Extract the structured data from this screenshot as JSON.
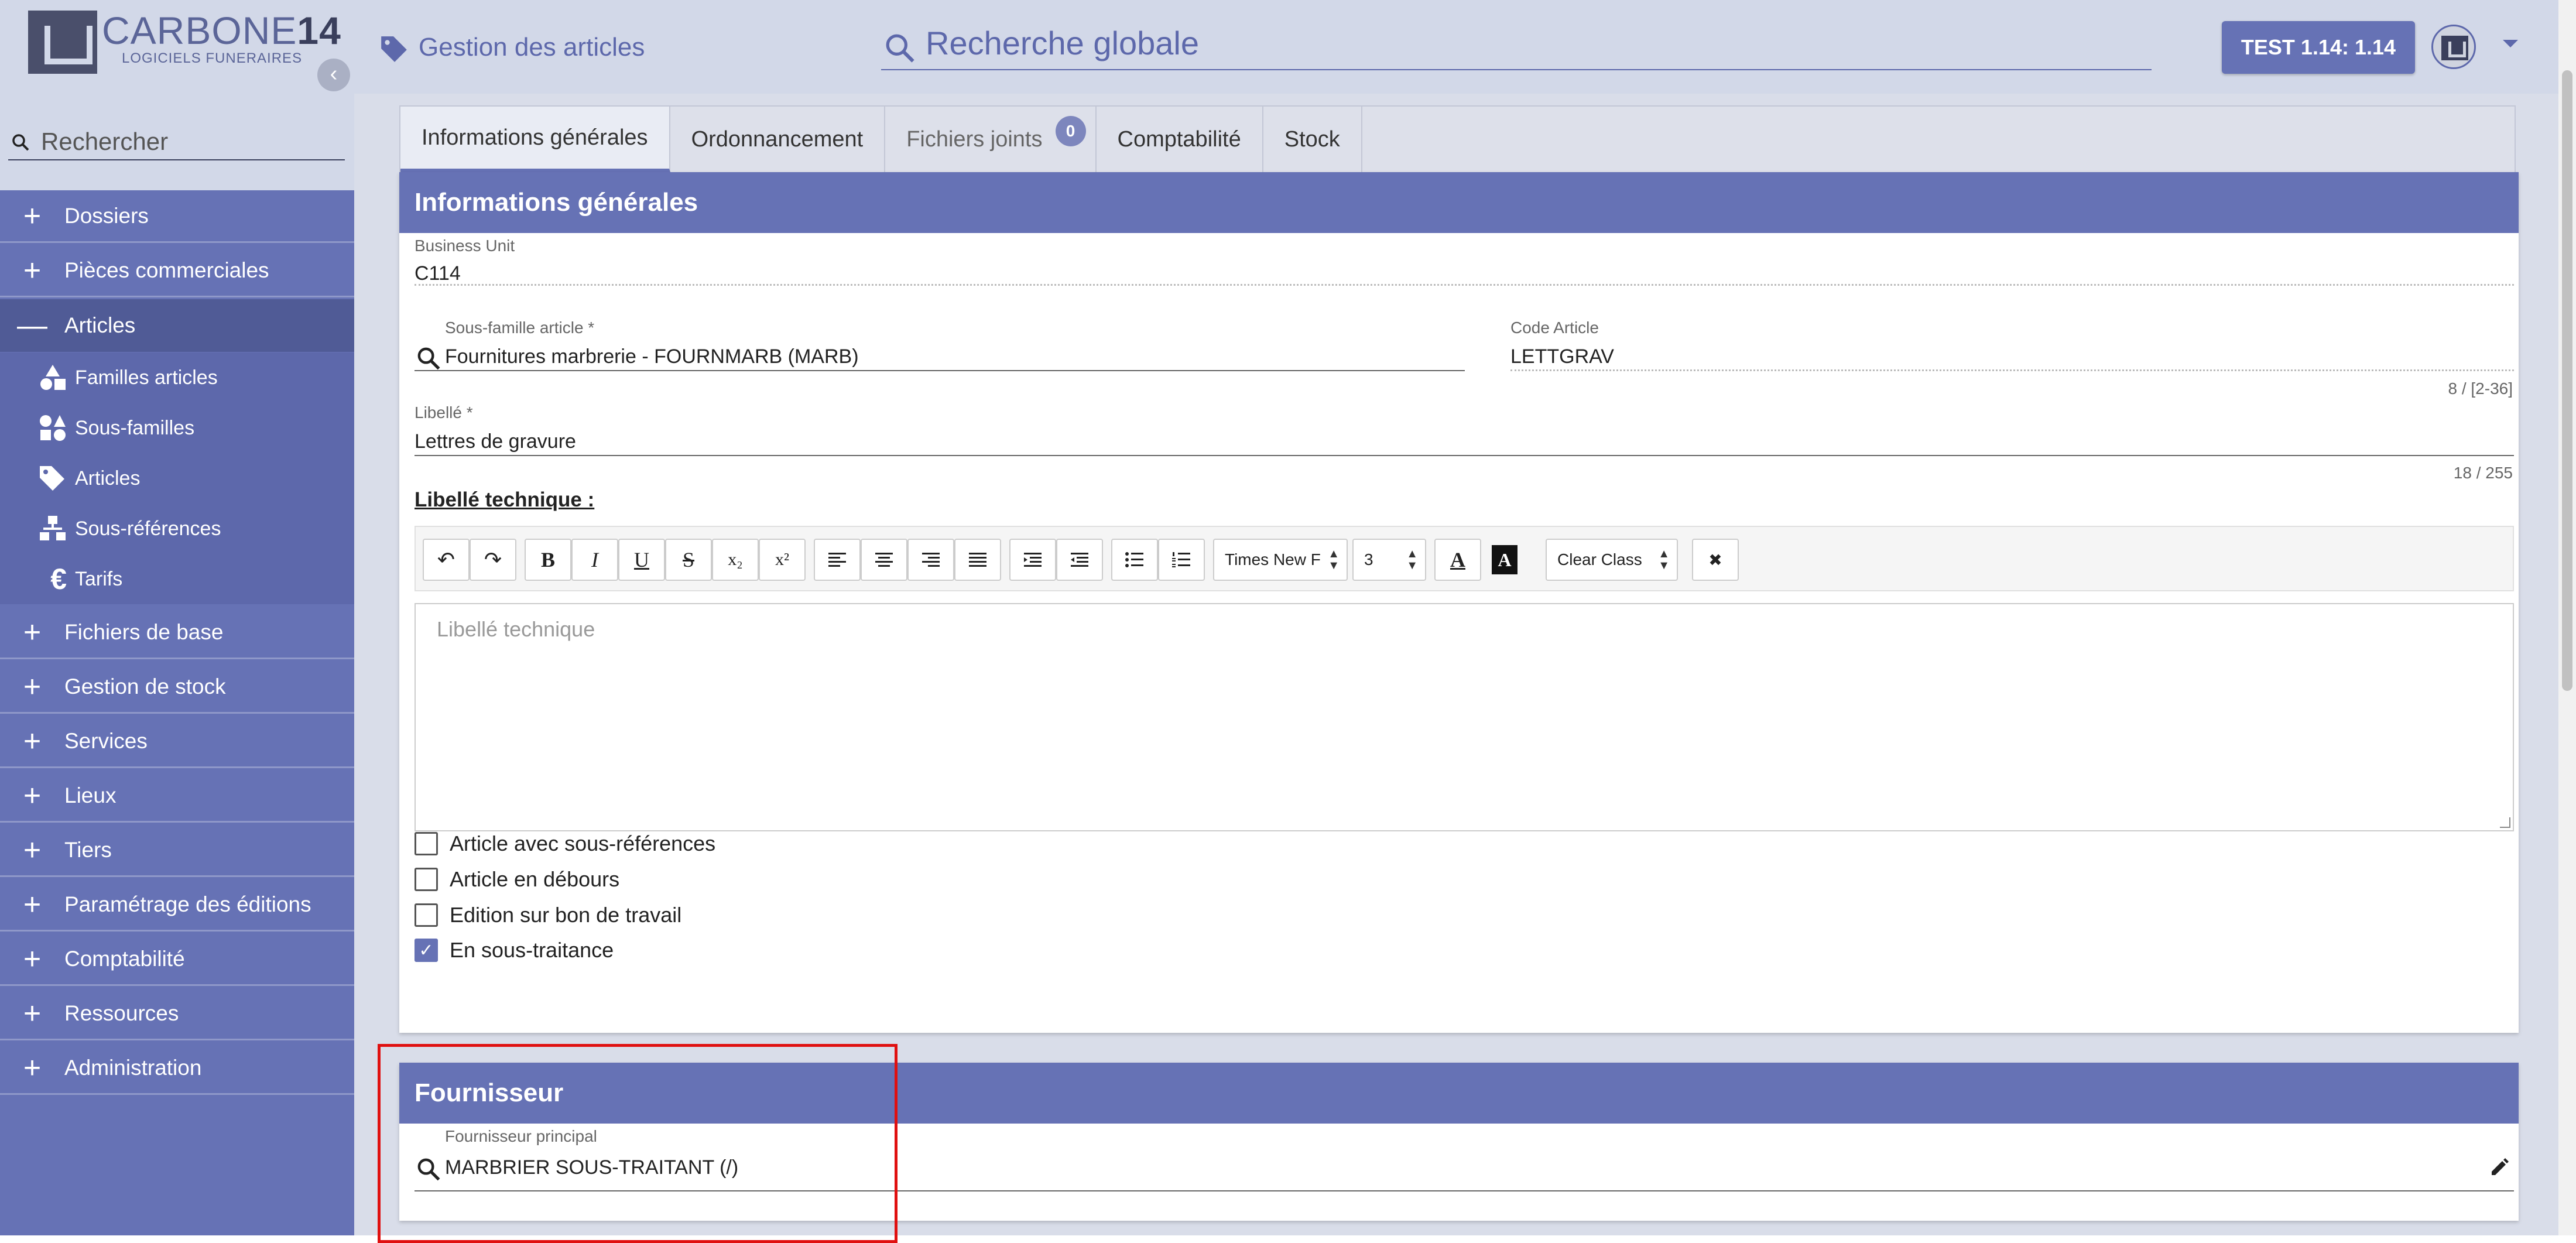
{
  "app": {
    "logo_word": "CARBONE",
    "logo_num": "14",
    "logo_sub": "LOGICIELS FUNERAIRES"
  },
  "sidebar": {
    "search_placeholder": "Rechercher",
    "items": [
      {
        "label": "Dossiers"
      },
      {
        "label": "Pièces commerciales"
      },
      {
        "label": "Articles"
      },
      {
        "label": "Fichiers de base"
      },
      {
        "label": "Gestion de stock"
      },
      {
        "label": "Services"
      },
      {
        "label": "Lieux"
      },
      {
        "label": "Tiers"
      },
      {
        "label": "Paramétrage des éditions"
      },
      {
        "label": "Comptabilité"
      },
      {
        "label": "Ressources"
      },
      {
        "label": "Administration"
      }
    ],
    "sub_items": [
      {
        "label": "Familles articles",
        "icon": "shapes-icon"
      },
      {
        "label": "Sous-familles",
        "icon": "shapes-grid-icon"
      },
      {
        "label": "Articles",
        "icon": "tag-icon"
      },
      {
        "label": "Sous-références",
        "icon": "hierarchy-icon"
      },
      {
        "label": "Tarifs",
        "icon": "euro-icon"
      }
    ]
  },
  "header": {
    "title": "Gestion des articles",
    "search_placeholder": "Recherche globale",
    "env_button": "TEST 1.14: 1.14"
  },
  "tabs": [
    {
      "label": "Informations générales"
    },
    {
      "label": "Ordonnancement"
    },
    {
      "label": "Fichiers joints",
      "badge": "0"
    },
    {
      "label": "Comptabilité"
    },
    {
      "label": "Stock"
    }
  ],
  "general": {
    "title": "Informations générales",
    "business_unit_label": "Business Unit",
    "business_unit_value": "C114",
    "subfamily_label": "Sous-famille article *",
    "subfamily_value": "Fournitures marbrerie - FOURNMARB (MARB)",
    "code_label": "Code Article",
    "code_value": "LETTGRAV",
    "code_counter": "8 / [2-36]",
    "libelle_label": "Libellé *",
    "libelle_value": "Lettres de gravure",
    "libelle_counter": "18 / 255",
    "tech_label": "Libellé technique :",
    "tech_placeholder": "Libellé technique",
    "font_name": "Times New F",
    "font_size": "3",
    "class_select": "Clear Class",
    "checkboxes": [
      {
        "label": "Article avec sous-références",
        "checked": false
      },
      {
        "label": "Article en débours",
        "checked": false
      },
      {
        "label": "Edition sur bon de travail",
        "checked": false
      },
      {
        "label": "En sous-traitance",
        "checked": true
      }
    ]
  },
  "supplier": {
    "title": "Fournisseur",
    "main_label": "Fournisseur principal",
    "main_value": "MARBRIER SOUS-TRAITANT (/)"
  },
  "toolbar_glyphs": {
    "undo": "↶",
    "redo": "↷",
    "bold": "B",
    "italic": "I",
    "underline": "U",
    "strike": "S",
    "sub": "x₂",
    "sup": "x²",
    "font_color": "A",
    "bg_color": "A",
    "remove": "✖"
  },
  "colors": {
    "accent": "#6672b5",
    "header_bg": "#d2d8e8",
    "highlight": "#e01010"
  }
}
